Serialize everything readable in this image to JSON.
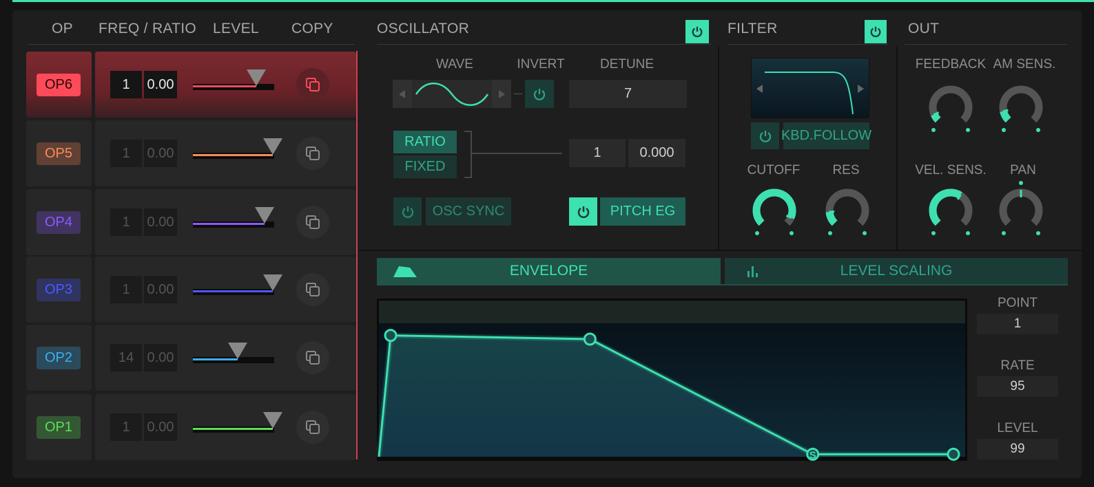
{
  "colors": {
    "accent": "#3ee0b0",
    "op6": "#ff4a5a",
    "op5": "#ff8a5a",
    "op4": "#8a5aff",
    "op3": "#4a5aff",
    "op2": "#3ab0f0",
    "op1": "#5ae05a"
  },
  "op_panel": {
    "headers": {
      "op": "OP",
      "freq": "FREQ / RATIO",
      "level": "LEVEL",
      "copy": "COPY"
    },
    "operators": [
      {
        "name": "OP6",
        "coarse": "1",
        "fine": "0.00",
        "level": 0.78,
        "active": true
      },
      {
        "name": "OP5",
        "coarse": "1",
        "fine": "0.00",
        "level": 0.98,
        "active": false
      },
      {
        "name": "OP4",
        "coarse": "1",
        "fine": "0.00",
        "level": 0.88,
        "active": false
      },
      {
        "name": "OP3",
        "coarse": "1",
        "fine": "0.00",
        "level": 0.98,
        "active": false
      },
      {
        "name": "OP2",
        "coarse": "14",
        "fine": "0.00",
        "level": 0.55,
        "active": false
      },
      {
        "name": "OP1",
        "coarse": "1",
        "fine": "0.00",
        "level": 0.98,
        "active": false
      }
    ]
  },
  "oscillator": {
    "title": "OSCILLATOR",
    "wave_label": "WAVE",
    "invert_label": "INVERT",
    "detune_label": "DETUNE",
    "detune_value": "7",
    "ratio_label": "RATIO",
    "fixed_label": "FIXED",
    "coarse_value": "1",
    "fine_value": "0.000",
    "osc_sync_label": "OSC SYNC",
    "pitch_eg_label": "PITCH EG"
  },
  "filter": {
    "title": "FILTER",
    "kbd_follow_label": "KBD.FOLLOW",
    "cutoff_label": "CUTOFF",
    "res_label": "RES",
    "cutoff_value": 0.92,
    "res_value": 0.15
  },
  "out": {
    "title": "OUT",
    "feedback_label": "FEEDBACK",
    "am_sens_label": "AM SENS.",
    "vel_sens_label": "VEL. SENS.",
    "pan_label": "PAN",
    "feedback_value": 0.08,
    "am_sens_value": 0.12,
    "vel_sens_value": 0.62,
    "pan_value": 0.5
  },
  "envelope": {
    "tab_envelope": "ENVELOPE",
    "tab_level_scaling": "LEVEL SCALING",
    "point_label": "POINT",
    "point_value": "1",
    "rate_label": "RATE",
    "rate_value": "95",
    "level_label": "LEVEL",
    "level_value": "99",
    "points": [
      {
        "t": 0.0,
        "l": 0.0
      },
      {
        "t": 0.02,
        "l": 0.98
      },
      {
        "t": 0.36,
        "l": 0.95
      },
      {
        "t": 0.74,
        "l": 0.02
      },
      {
        "t": 0.98,
        "l": 0.02
      }
    ],
    "sustain_marker": "S"
  }
}
